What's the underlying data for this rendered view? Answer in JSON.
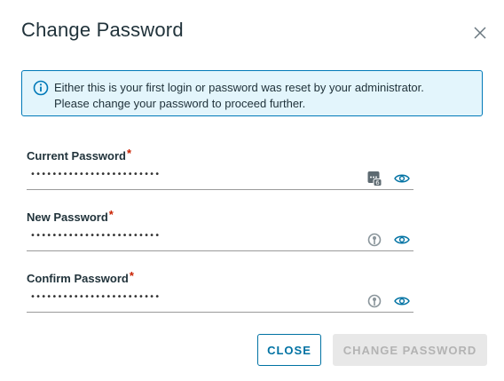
{
  "dialog": {
    "title": "Change Password"
  },
  "alert": {
    "line1": "Either this is your first login or password was reset by your administrator.",
    "line2": "Please change your password to proceed further.",
    "icon": "info-icon"
  },
  "fields": {
    "current": {
      "label": "Current Password",
      "required_mark": "*",
      "value_masked": "••••••••••••••••••••••••",
      "ext_icon": "password-manager-icon",
      "ext_badge": "6"
    },
    "new": {
      "label": "New Password",
      "required_mark": "*",
      "value_masked": "••••••••••••••••••••••••",
      "ext_icon": "key-generator-icon"
    },
    "confirm": {
      "label": "Confirm Password",
      "required_mark": "*",
      "value_masked": "••••••••••••••••••••••••",
      "ext_icon": "key-generator-icon"
    }
  },
  "buttons": {
    "close_label": "CLOSE",
    "change_label": "CHANGE PASSWORD"
  },
  "colors": {
    "accent": "#0072a3",
    "alert_bg": "#e3f5fc",
    "required": "#c92100",
    "disabled_bg": "#e8e8e8"
  }
}
